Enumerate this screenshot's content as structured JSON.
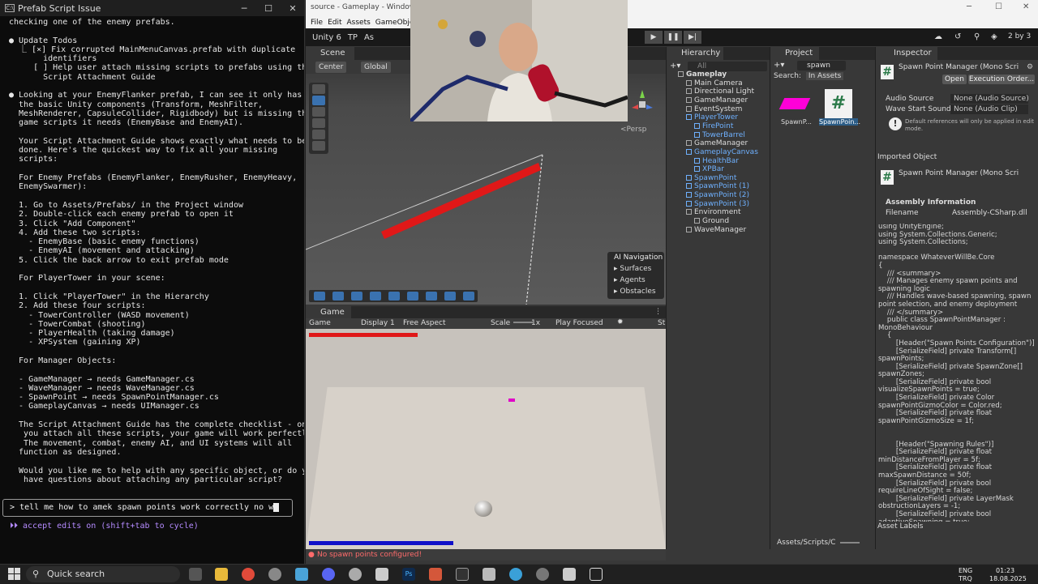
{
  "terminal": {
    "title": "Prefab Script Issue",
    "lines": [
      "checking one of the enemy prefabs.",
      "",
      "● Update Todos",
      "  ⎿ [×] Fix corrupted MainMenuCanvas.prefab with duplicate",
      "       identifiers",
      "     [ ] Help user attach missing scripts to prefabs using the",
      "       Script Attachment Guide",
      "",
      "● Looking at your EnemyFlanker prefab, I can see it only has",
      "  the basic Unity components (Transform, MeshFilter,",
      "  MeshRenderer, CapsuleCollider, Rigidbody) but is missing the",
      "  game scripts it needs (EnemyBase and EnemyAI).",
      "",
      "  Your Script Attachment Guide shows exactly what needs to be",
      "  done. Here's the quickest way to fix all your missing",
      "  scripts:",
      "",
      "  For Enemy Prefabs (EnemyFlanker, EnemyRusher, EnemyHeavy,",
      "  EnemySwarmer):",
      "",
      "  1. Go to Assets/Prefabs/ in the Project window",
      "  2. Double-click each enemy prefab to open it",
      "  3. Click \"Add Component\"",
      "  4. Add these two scripts:",
      "    - EnemyBase (basic enemy functions)",
      "    - EnemyAI (movement and attacking)",
      "  5. Click the back arrow to exit prefab mode",
      "",
      "  For PlayerTower in your scene:",
      "",
      "  1. Click \"PlayerTower\" in the Hierarchy",
      "  2. Add these four scripts:",
      "    - TowerController (WASD movement)",
      "    - TowerCombat (shooting)",
      "    - PlayerHealth (taking damage)",
      "    - XPSystem (gaining XP)",
      "",
      "  For Manager Objects:",
      "",
      "  - GameManager → needs GameManager.cs",
      "  - WaveManager → needs WaveManager.cs",
      "  - SpawnPoint → needs SpawnPointManager.cs",
      "  - GameplayCanvas → needs UIManager.cs",
      "",
      "  The Script Attachment Guide has the complete checklist - once",
      "   you attach all these scripts, your game will work perfectly!",
      "   The movement, combat, enemy AI, and UI systems will all",
      "  function as designed.",
      "",
      "  Would you like me to help with any specific object, or do you",
      "   have questions about attaching any particular script?"
    ],
    "input_prefix": ">",
    "input_value": "tell me how to amek spawn points work correctly no w",
    "status": "⏵⏵ accept edits on (shift+tab to cycle)"
  },
  "unity": {
    "window_title": "source - Gameplay - Windows,",
    "menu": [
      "File",
      "Edit",
      "Assets",
      "GameObject"
    ],
    "toolbar_project": "Unity 6",
    "toolbar_tp": "TP",
    "toolbar_as": "As",
    "layout_label": "2 by 3",
    "scene": {
      "tab": "Scene",
      "pivot": "Center",
      "space": "Global",
      "persp": "<Persp",
      "ai_nav": {
        "title": "AI Navigation",
        "items": [
          "Surfaces",
          "Agents",
          "Obstacles"
        ]
      }
    },
    "game": {
      "tab": "Game",
      "display_mode": "Game",
      "display": "Display 1",
      "aspect": "Free Aspect",
      "scale_label": "Scale",
      "scale_value": "1x",
      "play_mode": "Play Focused",
      "stats_label": "St"
    },
    "console_error": "No spawn points configured!",
    "hierarchy": {
      "tab": "Hierarchy",
      "search_placeholder": "All",
      "items": [
        {
          "label": "Gameplay",
          "depth": 0,
          "blue": false,
          "root": true
        },
        {
          "label": "Main Camera",
          "depth": 1,
          "blue": false
        },
        {
          "label": "Directional Light",
          "depth": 1,
          "blue": false
        },
        {
          "label": "GameManager",
          "depth": 1,
          "blue": false
        },
        {
          "label": "EventSystem",
          "depth": 1,
          "blue": false
        },
        {
          "label": "PlayerTower",
          "depth": 1,
          "blue": true
        },
        {
          "label": "FirePoint",
          "depth": 2,
          "blue": true
        },
        {
          "label": "TowerBarrel",
          "depth": 2,
          "blue": true
        },
        {
          "label": "GameManager",
          "depth": 1,
          "blue": false
        },
        {
          "label": "GameplayCanvas",
          "depth": 1,
          "blue": true
        },
        {
          "label": "HealthBar",
          "depth": 2,
          "blue": true
        },
        {
          "label": "XPBar",
          "depth": 2,
          "blue": true
        },
        {
          "label": "SpawnPoint",
          "depth": 1,
          "blue": true
        },
        {
          "label": "SpawnPoint (1)",
          "depth": 1,
          "blue": true
        },
        {
          "label": "SpawnPoint (2)",
          "depth": 1,
          "blue": true
        },
        {
          "label": "SpawnPoint (3)",
          "depth": 1,
          "blue": true
        },
        {
          "label": "Environment",
          "depth": 1,
          "blue": false
        },
        {
          "label": "Ground",
          "depth": 2,
          "blue": false
        },
        {
          "label": "WaveManager",
          "depth": 1,
          "blue": false
        }
      ]
    },
    "project": {
      "tab": "Project",
      "search_value": "spawn",
      "search_label": "Search:",
      "search_scope": "In Assets",
      "assets": [
        {
          "label": "SpawnP...",
          "kind": "material"
        },
        {
          "label": "SpawnPoin...",
          "kind": "script"
        }
      ],
      "path": "Assets/Scripts/C"
    },
    "inspector": {
      "tab": "Inspector",
      "component_title": "Spawn Point Manager (Mono Scri",
      "open_button": "Open",
      "exec_order_button": "Execution Order...",
      "fields": [
        {
          "label": "Audio Source",
          "value": "None (Audio Source)"
        },
        {
          "label": "Wave Start Sound",
          "value": "None (Audio Clip)"
        }
      ],
      "info": "Default references will only be applied in edit mode.",
      "imported_object": "Imported Object",
      "imported_title": "Spawn Point Manager (Mono Scri",
      "assembly_info": "Assembly Information",
      "filename_label": "Filename",
      "filename_value": "Assembly-CSharp.dll",
      "code": "using UnityEngine;\nusing System.Collections.Generic;\nusing System.Collections;\n\nnamespace WhateverWillBe.Core\n{\n    /// <summary>\n    /// Manages enemy spawn points and\nspawning logic\n    /// Handles wave-based spawning, spawn\npoint selection, and enemy deployment\n    /// </summary>\n    public class SpawnPointManager :\nMonoBehaviour\n    {\n        [Header(\"Spawn Points Configuration\")]\n        [SerializeField] private Transform[]\nspawnPoints;\n        [SerializeField] private SpawnZone[]\nspawnZones;\n        [SerializeField] private bool\nvisualizeSpawnPoints = true;\n        [SerializeField] private Color\nspawnPointGizmoColor = Color.red;\n        [SerializeField] private float\nspawnPointGizmoSize = 1f;\n\n\n        [Header(\"Spawning Rules\")]\n        [SerializeField] private float\nminDistanceFromPlayer = 5f;\n        [SerializeField] private float\nmaxSpawnDistance = 50f;\n        [SerializeField] private bool\nrequireLineOfSight = false;\n        [SerializeField] private LayerMask\nobstructionLayers = -1;\n        [SerializeField] private bool\nadaptiveSpawning = true;",
      "asset_labels": "Asset Labels"
    }
  },
  "taskbar": {
    "search": "Quick search",
    "lang_1": "ENG",
    "lang_2": "TRQ",
    "time": "01:23",
    "date": "18.08.2025"
  },
  "colors": {
    "accent_blue": "#3a72b0",
    "prefab_blue": "#6fb1ff",
    "error_red": "#ff6b6b",
    "claude_purple": "#b58bff"
  }
}
